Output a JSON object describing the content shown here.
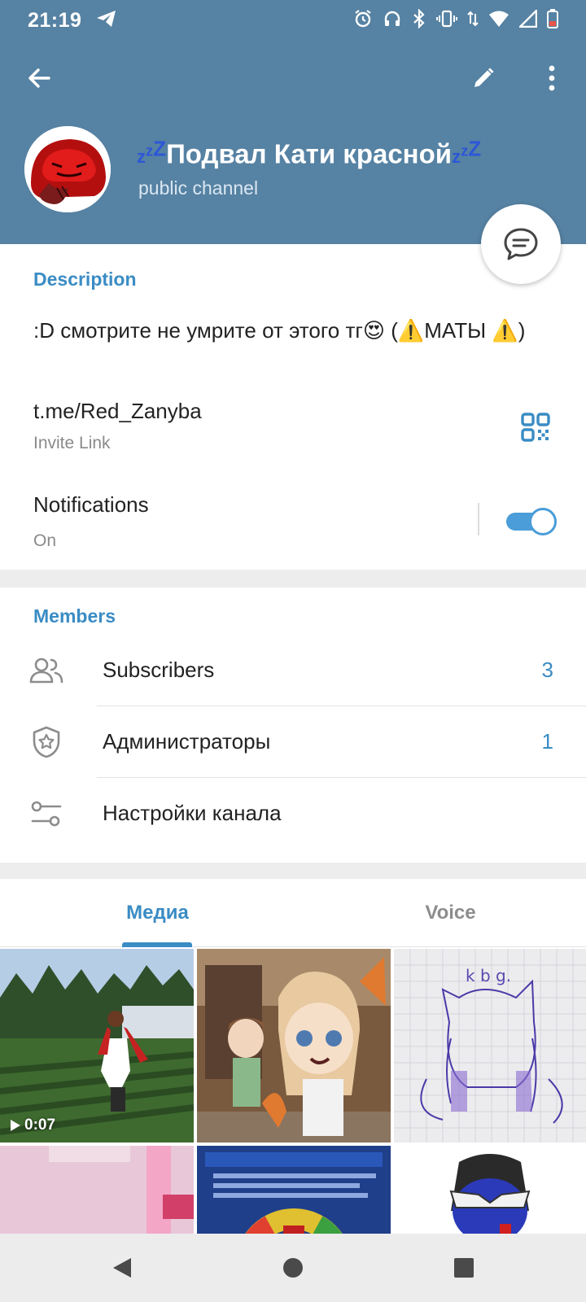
{
  "status_bar": {
    "time": "21:19",
    "icons": [
      "telegram-icon",
      "alarm-icon",
      "headphones-icon",
      "bluetooth-icon",
      "vibrate-icon",
      "data-arrows-icon",
      "wifi-icon",
      "signal-icon",
      "battery-low-icon"
    ]
  },
  "header": {
    "channel_name": "Подвал Кати красной",
    "channel_type": "public channel",
    "icons": [
      "back-arrow-icon",
      "edit-pencil-icon",
      "more-vertical-icon",
      "chat-bubble-icon"
    ]
  },
  "info": {
    "description_header": "Description",
    "description_text": ":D смотрите не умрите от этого тг😍 (⚠️МАТЫ ⚠️)",
    "link": "t.me/Red_Zanyba",
    "link_sub": "Invite Link",
    "notifications_label": "Notifications",
    "notifications_state": "On"
  },
  "members": {
    "header": "Members",
    "rows": [
      {
        "label": "Subscribers",
        "count": "3",
        "icon": "people-icon"
      },
      {
        "label": "Администраторы",
        "count": "1",
        "icon": "shield-star-icon"
      },
      {
        "label": "Настройки канала",
        "count": "",
        "icon": "sliders-icon"
      }
    ]
  },
  "media": {
    "tabs": [
      "Медиа",
      "Voice"
    ],
    "active_tab": "Медиа",
    "video_duration": "0:07"
  },
  "colors": {
    "header_bg": "#5682a3",
    "accent": "#3a8cc4",
    "toggle": "#4a9dd8"
  }
}
